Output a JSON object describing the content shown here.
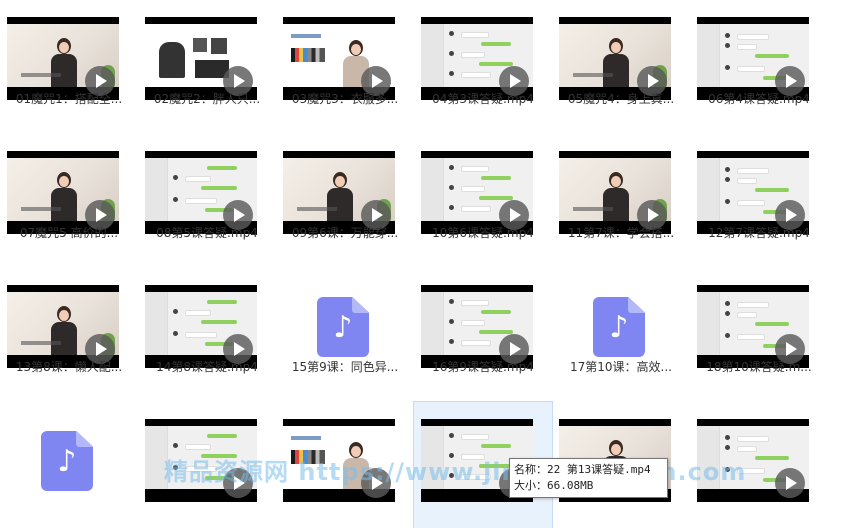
{
  "files": [
    {
      "label": "01魔咒1：搭配全...",
      "kind": "person"
    },
    {
      "label": "02魔咒2：胖人只...",
      "kind": "slide-dark"
    },
    {
      "label": "03魔咒3：衣服多...",
      "kind": "slide-person"
    },
    {
      "label": "04第3课答疑.mp4",
      "kind": "chat"
    },
    {
      "label": "05魔咒4：身上真...",
      "kind": "person"
    },
    {
      "label": "06第4课答疑.mp4",
      "kind": "chat"
    },
    {
      "label": "07魔咒5 高价的...",
      "kind": "person"
    },
    {
      "label": "08第5课答疑.mp4",
      "kind": "chat"
    },
    {
      "label": "09第6课：万能穿...",
      "kind": "person"
    },
    {
      "label": "10第6课答疑.mp4",
      "kind": "chat"
    },
    {
      "label": "11第7课：学会搭...",
      "kind": "person"
    },
    {
      "label": "12第7课答疑.mp4",
      "kind": "chat"
    },
    {
      "label": "13第8课：懒人配...",
      "kind": "person"
    },
    {
      "label": "14第8课答疑.mp4",
      "kind": "chat"
    },
    {
      "label": "15第9课：同色异...",
      "kind": "audio"
    },
    {
      "label": "16第9课答疑.mp4",
      "kind": "chat"
    },
    {
      "label": "17第10课：高效...",
      "kind": "audio"
    },
    {
      "label": "18第10课答疑.m...",
      "kind": "chat"
    },
    {
      "label": "",
      "kind": "audio"
    },
    {
      "label": "",
      "kind": "chat"
    },
    {
      "label": "",
      "kind": "slide-person"
    },
    {
      "label": "",
      "kind": "chat"
    },
    {
      "label": "",
      "kind": "person"
    },
    {
      "label": "",
      "kind": "chat"
    }
  ],
  "tooltip": {
    "name_line": "名称：22 第13课答疑.mp4",
    "size_line": "大小：66.08MB"
  },
  "watermark": "精品资源网 https://www.jingpinziyuan.com",
  "icons": {
    "video_overlay": "play-icon",
    "audio_file": "music-file-icon"
  },
  "colors": {
    "audio_icon": "#7f86f2",
    "hover_bg": "#e8f2fd",
    "chat_green": "#8fd05f"
  }
}
